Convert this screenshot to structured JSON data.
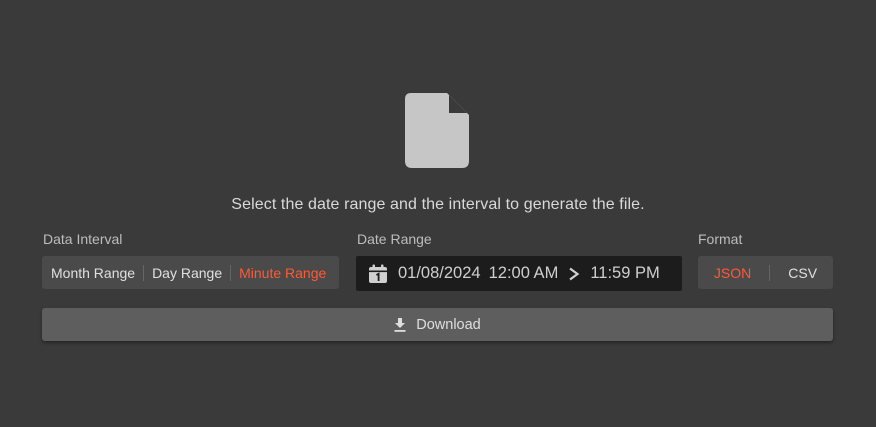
{
  "message": "Select the date range and the interval to generate the file.",
  "data_interval": {
    "label": "Data Interval",
    "options": [
      "Month Range",
      "Day Range",
      "Minute Range"
    ],
    "selected": "Minute Range"
  },
  "date_range": {
    "label": "Date Range",
    "date": "01/08/2024",
    "start_time": "12:00 AM",
    "end_time": "11:59 PM",
    "calendar_icon": "calendar-icon",
    "arrow_icon": "chevron-right-icon"
  },
  "format": {
    "label": "Format",
    "options": [
      "JSON",
      "CSV"
    ],
    "selected": "JSON"
  },
  "download": {
    "label": "Download",
    "icon": "download-icon"
  },
  "colors": {
    "background": "#3a3a3a",
    "accent": "#ff5a36",
    "button": "#5e5e5e",
    "date_field": "#1c1c1c"
  }
}
